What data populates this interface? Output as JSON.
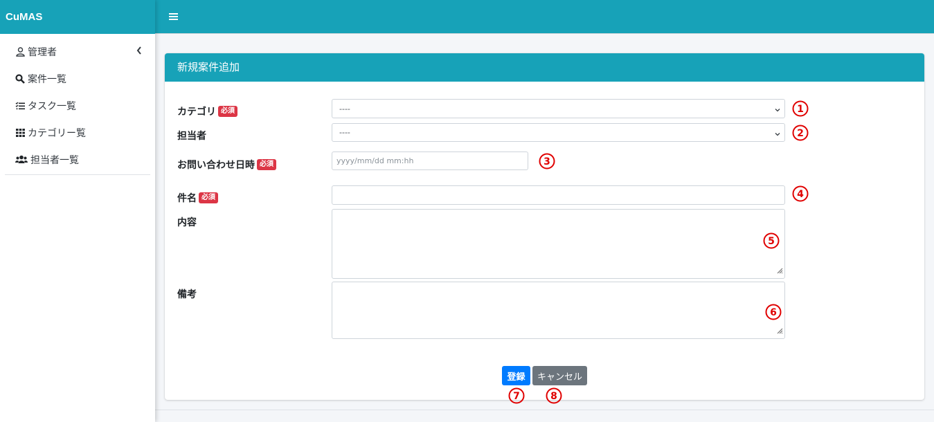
{
  "app": {
    "brand": "CuMAS"
  },
  "sidebar": {
    "items": [
      {
        "label": "管理者",
        "icon": "user-icon"
      },
      {
        "label": "案件一覧",
        "icon": "search-icon"
      },
      {
        "label": "タスク一覧",
        "icon": "tasks-list-icon"
      },
      {
        "label": "カテゴリー覧",
        "icon": "grid-icon"
      },
      {
        "label": "担当者一覧",
        "icon": "users-icon"
      }
    ]
  },
  "colors": {
    "accent": "#17a2b8",
    "required_badge": "#dc3545",
    "primary": "#007bff",
    "secondary": "#6c757d",
    "annotation": "#e00000"
  },
  "page": {
    "title": "新規案件追加"
  },
  "form": {
    "required_badge": "必須",
    "category": {
      "label": "カテゴリ",
      "value": "----"
    },
    "assignee": {
      "label": "担当者",
      "value": "----"
    },
    "inquiry_datetime": {
      "label": "お問い合わせ日時",
      "placeholder": "yyyy/mm/dd mm:hh",
      "value": ""
    },
    "subject": {
      "label": "件名",
      "value": ""
    },
    "content": {
      "label": "内容",
      "value": ""
    },
    "remarks": {
      "label": "備考",
      "value": ""
    },
    "submit_label": "登録",
    "cancel_label": "キャンセル"
  },
  "annotations": [
    "①",
    "②",
    "③",
    "④",
    "⑤",
    "⑥",
    "⑦",
    "⑧"
  ]
}
